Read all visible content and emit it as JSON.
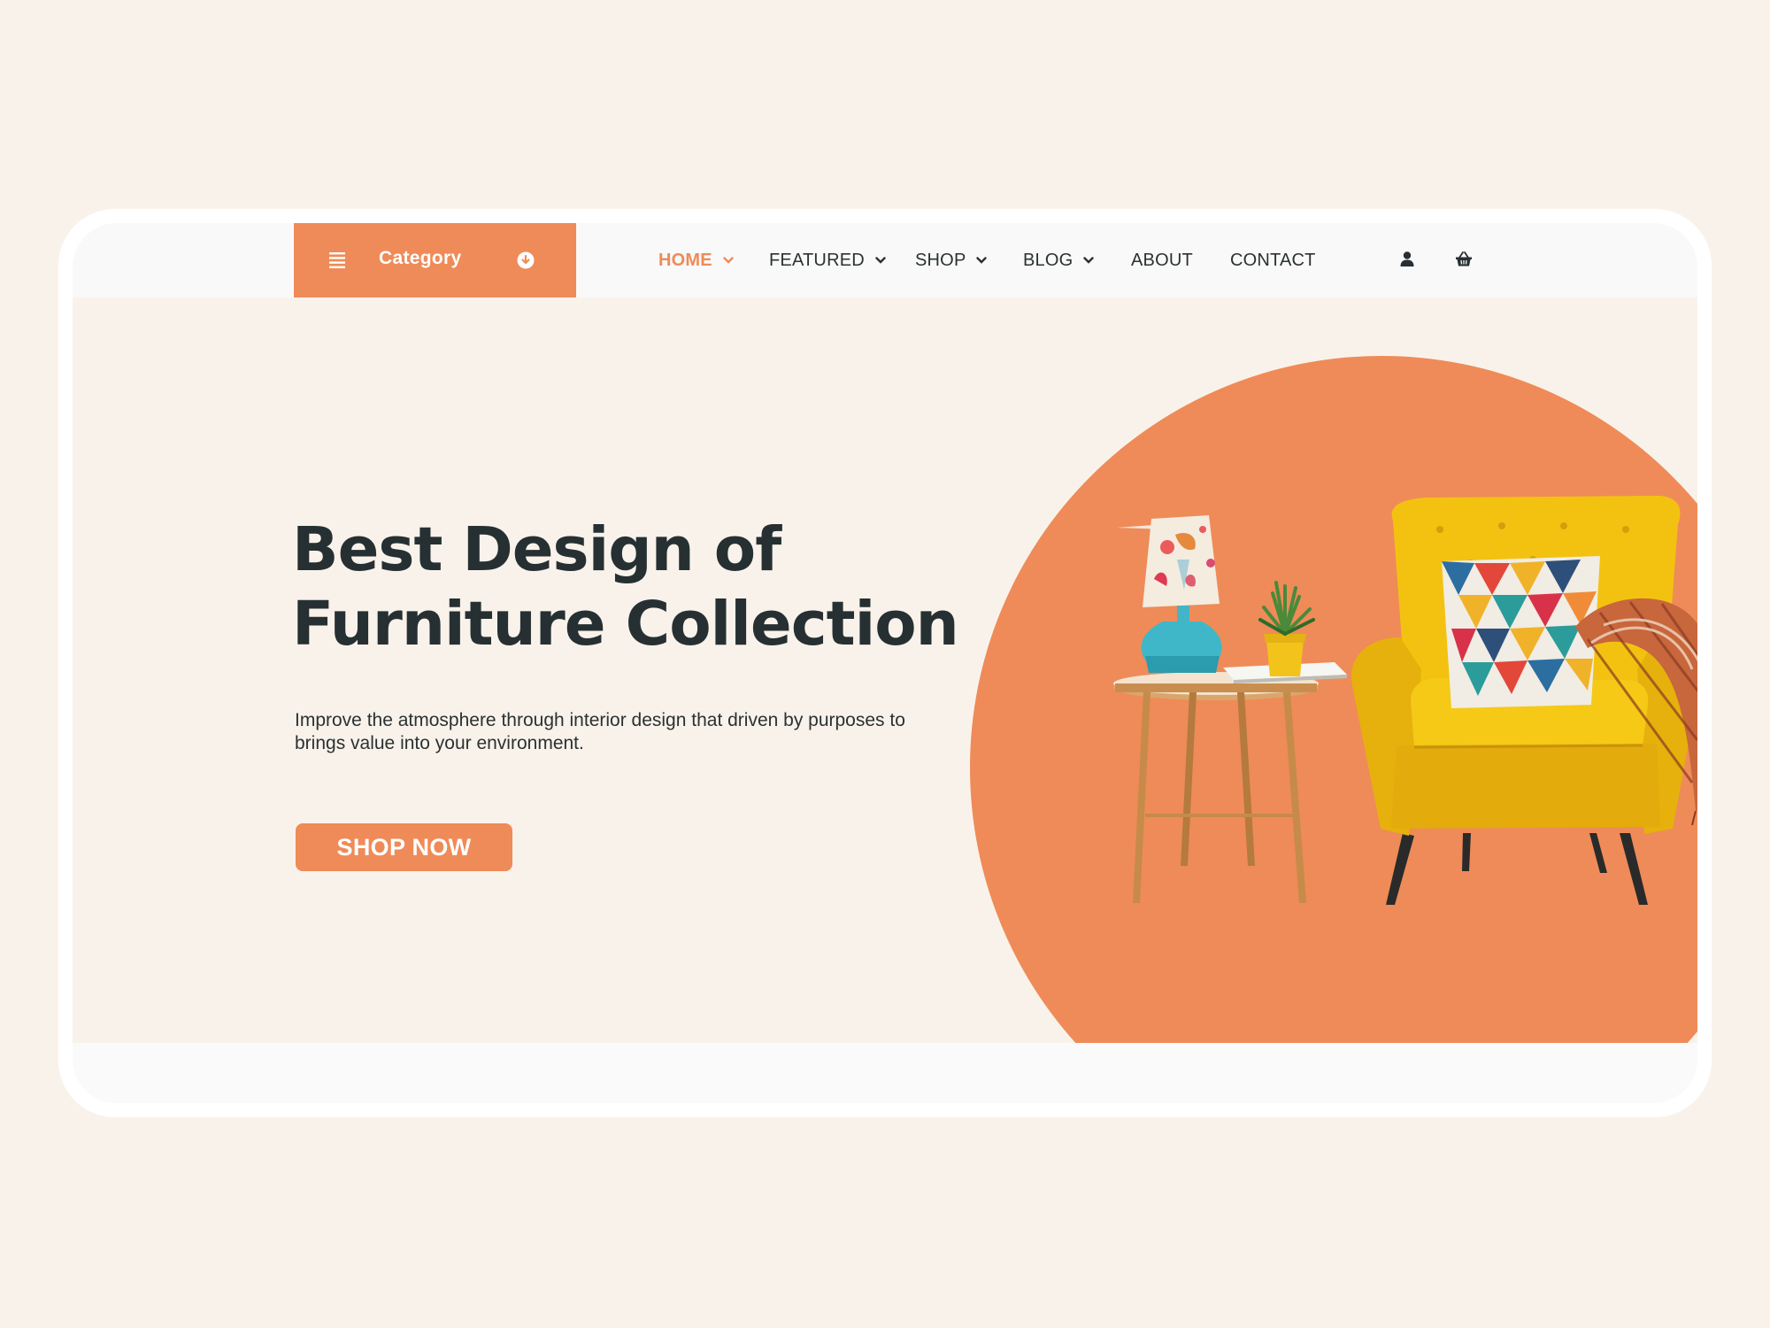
{
  "nav": {
    "category_label": "Category",
    "items": [
      {
        "label": "HOME",
        "active": true,
        "has_dropdown": true
      },
      {
        "label": "FEATURED",
        "active": false,
        "has_dropdown": true
      },
      {
        "label": "SHOP",
        "active": false,
        "has_dropdown": true
      },
      {
        "label": "BLOG",
        "active": false,
        "has_dropdown": true
      },
      {
        "label": "ABOUT",
        "active": false,
        "has_dropdown": false
      },
      {
        "label": "CONTACT",
        "active": false,
        "has_dropdown": false
      }
    ],
    "icons": [
      "menu-icon",
      "dropdown-circle-icon",
      "user-icon",
      "basket-icon"
    ]
  },
  "hero": {
    "headline_line1": "Best Design of",
    "headline_line2": "Furniture Collection",
    "subtext": "Improve the atmosphere through interior design that driven by purposes to brings value into your environment.",
    "cta_label": "SHOP NOW"
  },
  "colors": {
    "accent": "#ef8b58",
    "page_background": "#f9f2eb",
    "dark_text": "#263032",
    "chair_yellow": "#f2c114"
  }
}
